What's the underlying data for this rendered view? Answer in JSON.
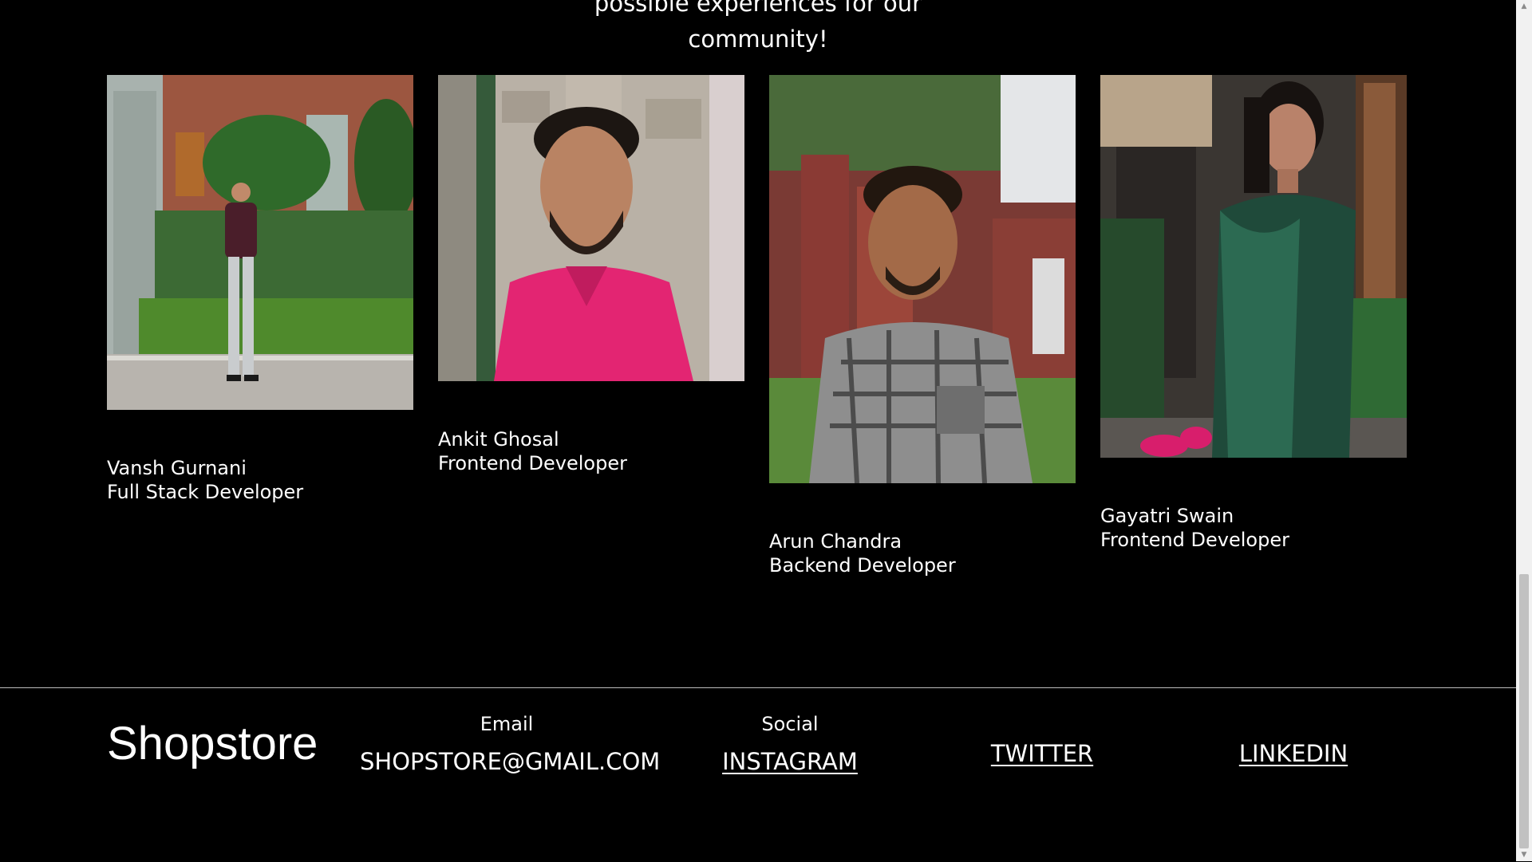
{
  "intro": {
    "line1": "possible experiences for our",
    "line2": "community!"
  },
  "team": [
    {
      "name": "Vansh Gurnani",
      "role": "Full Stack Developer",
      "photo": "vansh-photo"
    },
    {
      "name": "Ankit Ghosal",
      "role": "Frontend Developer",
      "photo": "ankit-photo"
    },
    {
      "name": "Arun Chandra",
      "role": "Backend Developer",
      "photo": "arun-photo"
    },
    {
      "name": "Gayatri Swain",
      "role": "Frontend Developer",
      "photo": "gayatri-photo"
    }
  ],
  "footer": {
    "brand": "Shopstore",
    "email_label": "Email",
    "email_value": "SHOPSTORE@GMAIL.COM",
    "social_label": "Social",
    "instagram": "INSTAGRAM",
    "twitter": "TWITTER",
    "linkedin": "LINKEDIN"
  },
  "colors": {
    "background": "#000000",
    "text": "#ffffff",
    "divider": "#bdbdbd"
  }
}
